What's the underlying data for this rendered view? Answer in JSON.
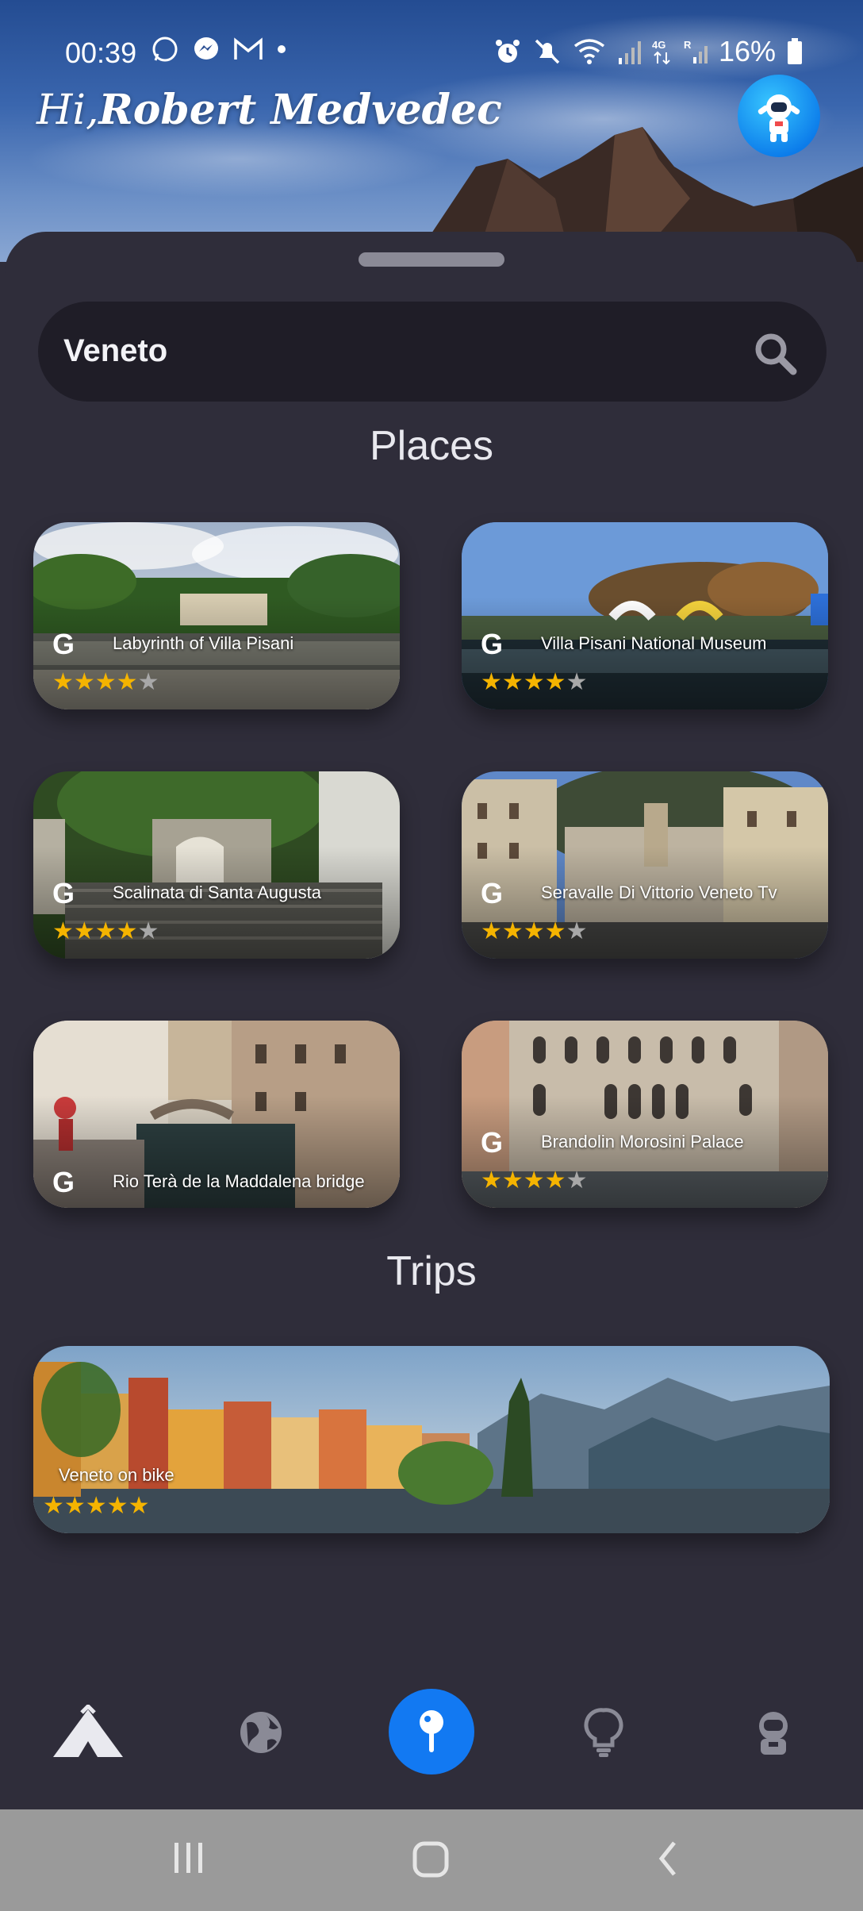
{
  "status_bar": {
    "time": "00:39",
    "battery": "16%",
    "left_icons": [
      "whatsapp-icon",
      "messenger-icon",
      "gmail-icon",
      "dot-icon"
    ],
    "right_icons": [
      "alarm-icon",
      "mute-icon",
      "wifi-icon",
      "signal-icon",
      "network-4g-icon",
      "signal-r-icon",
      "battery-icon"
    ]
  },
  "header": {
    "greeting_prefix": "Hi,",
    "user_name": "Robert Medvedec"
  },
  "search": {
    "value": "Veneto"
  },
  "places": {
    "title": "Places",
    "items": [
      {
        "name": "Labyrinth of Villa Pisani",
        "rating": 4.5,
        "source": "google"
      },
      {
        "name": "Villa Pisani National Museum",
        "rating": 4.5,
        "source": "google"
      },
      {
        "name": "Scalinata di Santa Augusta",
        "rating": 4.5,
        "source": "google"
      },
      {
        "name": "Seravalle Di Vittorio Veneto Tv",
        "rating": 4.5,
        "source": "google"
      },
      {
        "name": "Rio Terà de la Maddalena bridge",
        "source": "google"
      },
      {
        "name": "Brandolin Morosini Palace",
        "rating": 4.5,
        "source": "google"
      }
    ]
  },
  "trips": {
    "title": "Trips",
    "items": [
      {
        "name": "Veneto on bike",
        "rating": 5
      }
    ]
  },
  "bottom_nav": {
    "items": [
      "camp-icon",
      "globe-icon",
      "pin-icon",
      "lightbulb-icon",
      "astronaut-icon"
    ],
    "active": "pin-icon",
    "accent": "#1279f2"
  },
  "colors": {
    "background": "#2f2d3a",
    "search_bg": "#1f1d27",
    "star": "#f5b400"
  }
}
